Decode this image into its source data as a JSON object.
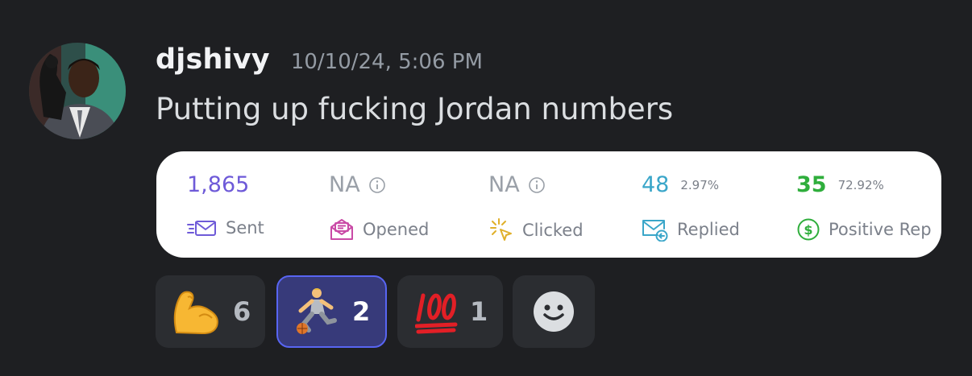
{
  "message": {
    "username": "djshivy",
    "timestamp": "10/10/24, 5:06 PM",
    "content": "Putting up fucking Jordan numbers"
  },
  "stats": [
    {
      "value": "1,865",
      "percent": "",
      "label": "Sent",
      "icon": "send-mail-icon",
      "color": "#6e5ad8",
      "info": false
    },
    {
      "value": "NA",
      "percent": "",
      "label": "Opened",
      "icon": "open-mail-icon",
      "color": "#9aa0a8",
      "info": true
    },
    {
      "value": "NA",
      "percent": "",
      "label": "Clicked",
      "icon": "click-cursor-icon",
      "color": "#9aa0a8",
      "info": true
    },
    {
      "value": "48",
      "percent": "2.97%",
      "label": "Replied",
      "icon": "reply-mail-icon",
      "color": "#3aa6c9",
      "info": false
    },
    {
      "value": "35",
      "percent": "72.92%",
      "label": "Positive Rep",
      "icon": "dollar-circle-icon",
      "color": "#2fae3c",
      "info": false
    }
  ],
  "reactions": [
    {
      "emoji": "flexed-biceps",
      "count": "6",
      "active": false
    },
    {
      "emoji": "person-bouncing-ball",
      "count": "2",
      "active": true
    },
    {
      "emoji": "hundred-points",
      "count": "1",
      "active": false
    },
    {
      "emoji": "add-reaction",
      "count": "",
      "active": false
    }
  ],
  "colors": {
    "background": "#1e1f22",
    "username": "#f2f3f5",
    "timestamp": "#949ba4",
    "content": "#dbdee1",
    "reaction_bg": "#2b2d31",
    "reaction_active_bg": "#373a7a",
    "reaction_active_border": "#5865f2"
  }
}
